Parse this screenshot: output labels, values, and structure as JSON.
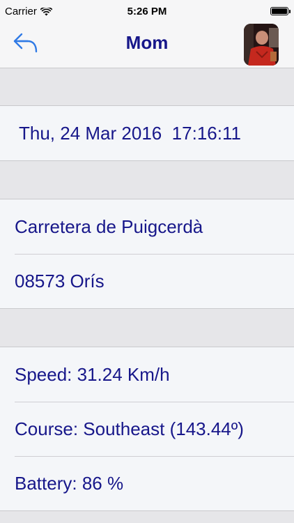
{
  "status_bar": {
    "carrier": "Carrier",
    "time": "5:26 PM",
    "battery_level": 1.0
  },
  "nav": {
    "title": "Mom",
    "back_icon": "reply-arrow-icon",
    "avatar_icon": "contact-photo"
  },
  "date_section": {
    "datetime": "Thu, 24 Mar 2016  17:16:11"
  },
  "address_section": {
    "street": "Carretera de Puigcerdà",
    "postal_city": "08573 Orís"
  },
  "info_section": {
    "speed": "Speed: 31.24 Km/h",
    "course": "Course: Southeast (143.44º)",
    "battery": "Battery: 86 %"
  },
  "colors": {
    "accent": "#17178a",
    "back_icon": "#2f7ae5",
    "cell_background": "#f4f6f9",
    "group_background": "#e6e6e9"
  }
}
